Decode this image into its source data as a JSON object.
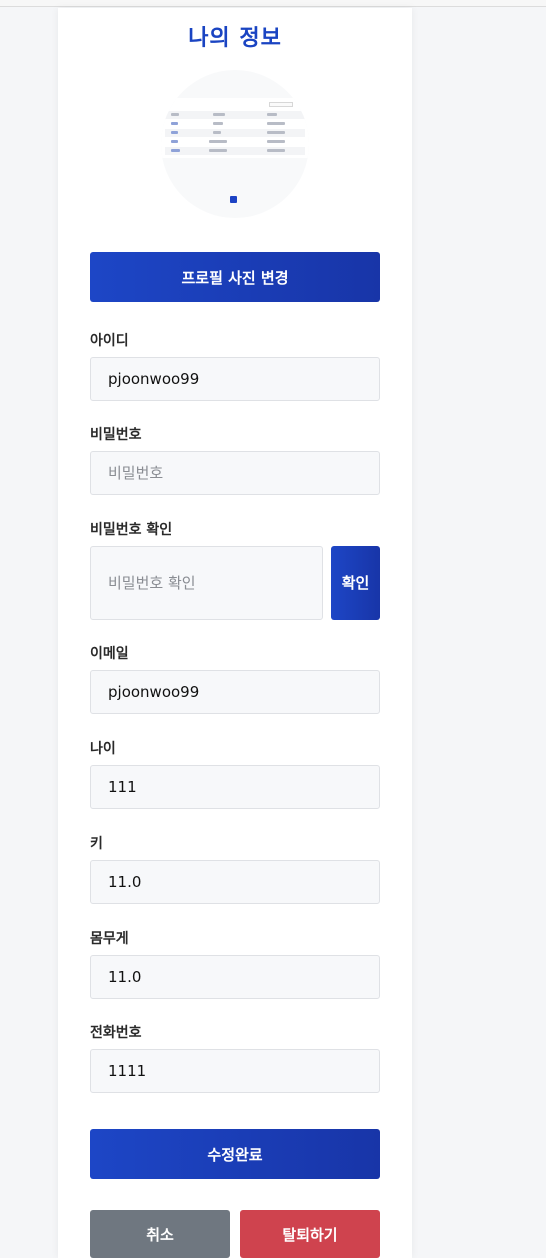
{
  "page": {
    "title": "나의 정보"
  },
  "profile": {
    "change_photo_label": "프로필 사진 변경",
    "image_icon": "profile-thumbnail"
  },
  "fields": {
    "id": {
      "label": "아이디",
      "value": "pjoonwoo99"
    },
    "password": {
      "label": "비밀번호",
      "placeholder": "비밀번호"
    },
    "password_confirm": {
      "label": "비밀번호 확인",
      "placeholder": "비밀번호 확인",
      "button": "확인"
    },
    "email": {
      "label": "이메일",
      "value": "pjoonwoo99"
    },
    "age": {
      "label": "나이",
      "value": "111"
    },
    "height": {
      "label": "키",
      "value": "11.0"
    },
    "weight": {
      "label": "몸무게",
      "value": "11.0"
    },
    "phone": {
      "label": "전화번호",
      "value": "1111"
    }
  },
  "actions": {
    "submit": "수정완료",
    "cancel": "취소",
    "withdraw": "탈퇴하기"
  },
  "colors": {
    "accent": "#1d46c6",
    "cancel": "#6f7780",
    "danger": "#cf434e",
    "background": "#f5f6f8"
  }
}
